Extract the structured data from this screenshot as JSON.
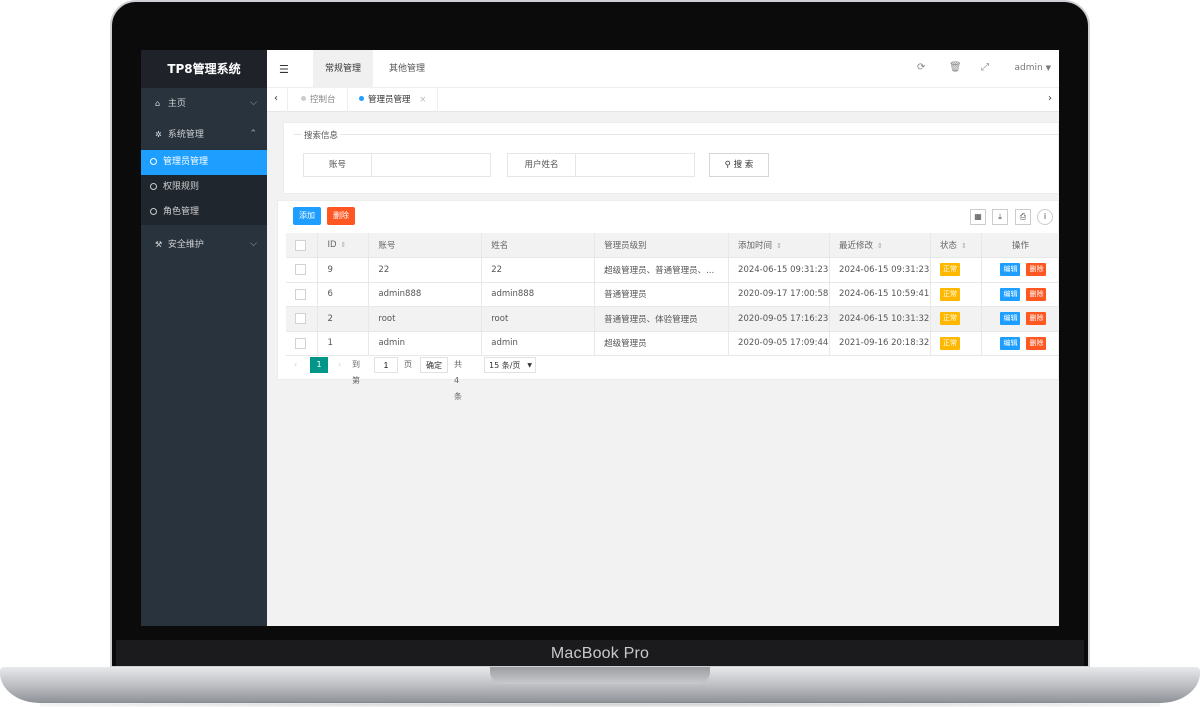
{
  "device": {
    "brand": "MacBook Pro"
  },
  "app": {
    "title": "TP8管理系统"
  },
  "sidebar": {
    "items": [
      {
        "icon": "home-icon",
        "glyph": "⌂",
        "label": "主页"
      },
      {
        "icon": "gears-icon",
        "glyph": "✲",
        "label": "系统管理"
      },
      {
        "icon": "wrench-icon",
        "glyph": "⚒",
        "label": "安全维护"
      }
    ],
    "sub_items": [
      {
        "label": "管理员管理",
        "active": true
      },
      {
        "label": "权限规则",
        "active": false
      },
      {
        "label": "角色管理",
        "active": false
      }
    ]
  },
  "header": {
    "tabs": [
      {
        "label": "常规管理",
        "active": true
      },
      {
        "label": "其他管理",
        "active": false
      }
    ],
    "user": "admin",
    "icons": [
      "refresh-icon",
      "trash-icon",
      "fullscreen-icon"
    ]
  },
  "tabbar": {
    "tabs": [
      {
        "label": "控制台",
        "active": false
      },
      {
        "label": "管理员管理",
        "active": true
      }
    ],
    "close_glyph": "×"
  },
  "search": {
    "legend": "搜索信息",
    "fields": [
      {
        "label": "账号",
        "value": ""
      },
      {
        "label": "用户姓名",
        "value": ""
      }
    ],
    "button": "搜 索"
  },
  "toolbar": {
    "add": "添加",
    "delete": "删除"
  },
  "table": {
    "headers": [
      "ID",
      "账号",
      "姓名",
      "管理员级别",
      "添加时间",
      "最近修改",
      "状态",
      "操作"
    ],
    "rows": [
      {
        "id": "9",
        "account": "22",
        "name": "22",
        "level": "超级管理员、普通管理员、...",
        "created": "2024-06-15 09:31:23",
        "modified": "2024-06-15 09:31:23",
        "status": "正常"
      },
      {
        "id": "6",
        "account": "admin888",
        "name": "admin888",
        "level": "普通管理员",
        "created": "2020-09-17 17:00:58",
        "modified": "2024-06-15 10:59:41",
        "status": "正常"
      },
      {
        "id": "2",
        "account": "root",
        "name": "root",
        "level": "普通管理员、体验管理员",
        "created": "2020-09-05 17:16:23",
        "modified": "2024-06-15 10:31:32",
        "status": "正常"
      },
      {
        "id": "1",
        "account": "admin",
        "name": "admin",
        "level": "超级管理员",
        "created": "2020-09-05 17:09:44",
        "modified": "2021-09-16 20:18:32",
        "status": "正常"
      }
    ],
    "edit_label": "编辑",
    "delete_label": "删除"
  },
  "pagination": {
    "current_page": "1",
    "goto_prefix": "到第",
    "goto_value": "1",
    "goto_suffix": "页",
    "confirm": "确定",
    "total": "共 4 条",
    "page_size": "15 条/页"
  },
  "colors": {
    "sidebar": "#28333e",
    "accent": "#1e9fff",
    "danger": "#ff5722",
    "warn": "#ffb800",
    "page_active": "#009688"
  }
}
